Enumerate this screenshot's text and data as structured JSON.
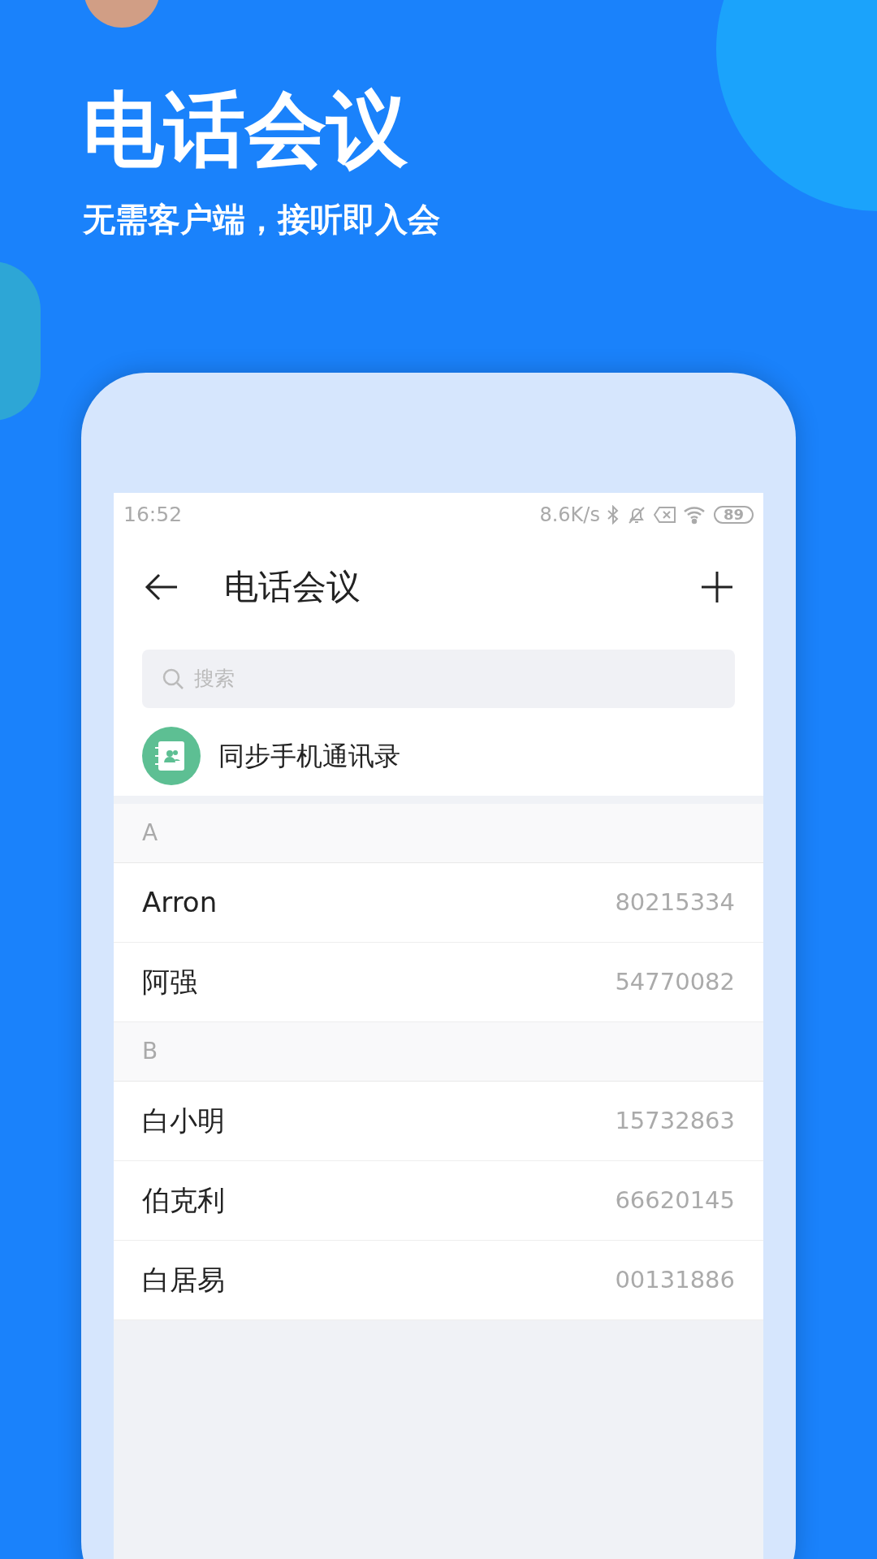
{
  "headline": "电话会议",
  "subtitle": "无需客户端，接听即入会",
  "status_bar": {
    "time": "16:52",
    "speed": "8.6K/s",
    "battery": "89"
  },
  "app_bar": {
    "title": "电话会议"
  },
  "search": {
    "placeholder": "搜索"
  },
  "sync_row": {
    "label": "同步手机通讯录"
  },
  "sections": [
    {
      "letter": "A",
      "contacts": [
        {
          "name": "Arron",
          "number": "80215334"
        },
        {
          "name": "阿强",
          "number": "54770082"
        }
      ]
    },
    {
      "letter": "B",
      "contacts": [
        {
          "name": "白小明",
          "number": "15732863"
        },
        {
          "name": "伯克利",
          "number": "66620145"
        },
        {
          "name": "白居易",
          "number": "00131886"
        }
      ]
    }
  ]
}
